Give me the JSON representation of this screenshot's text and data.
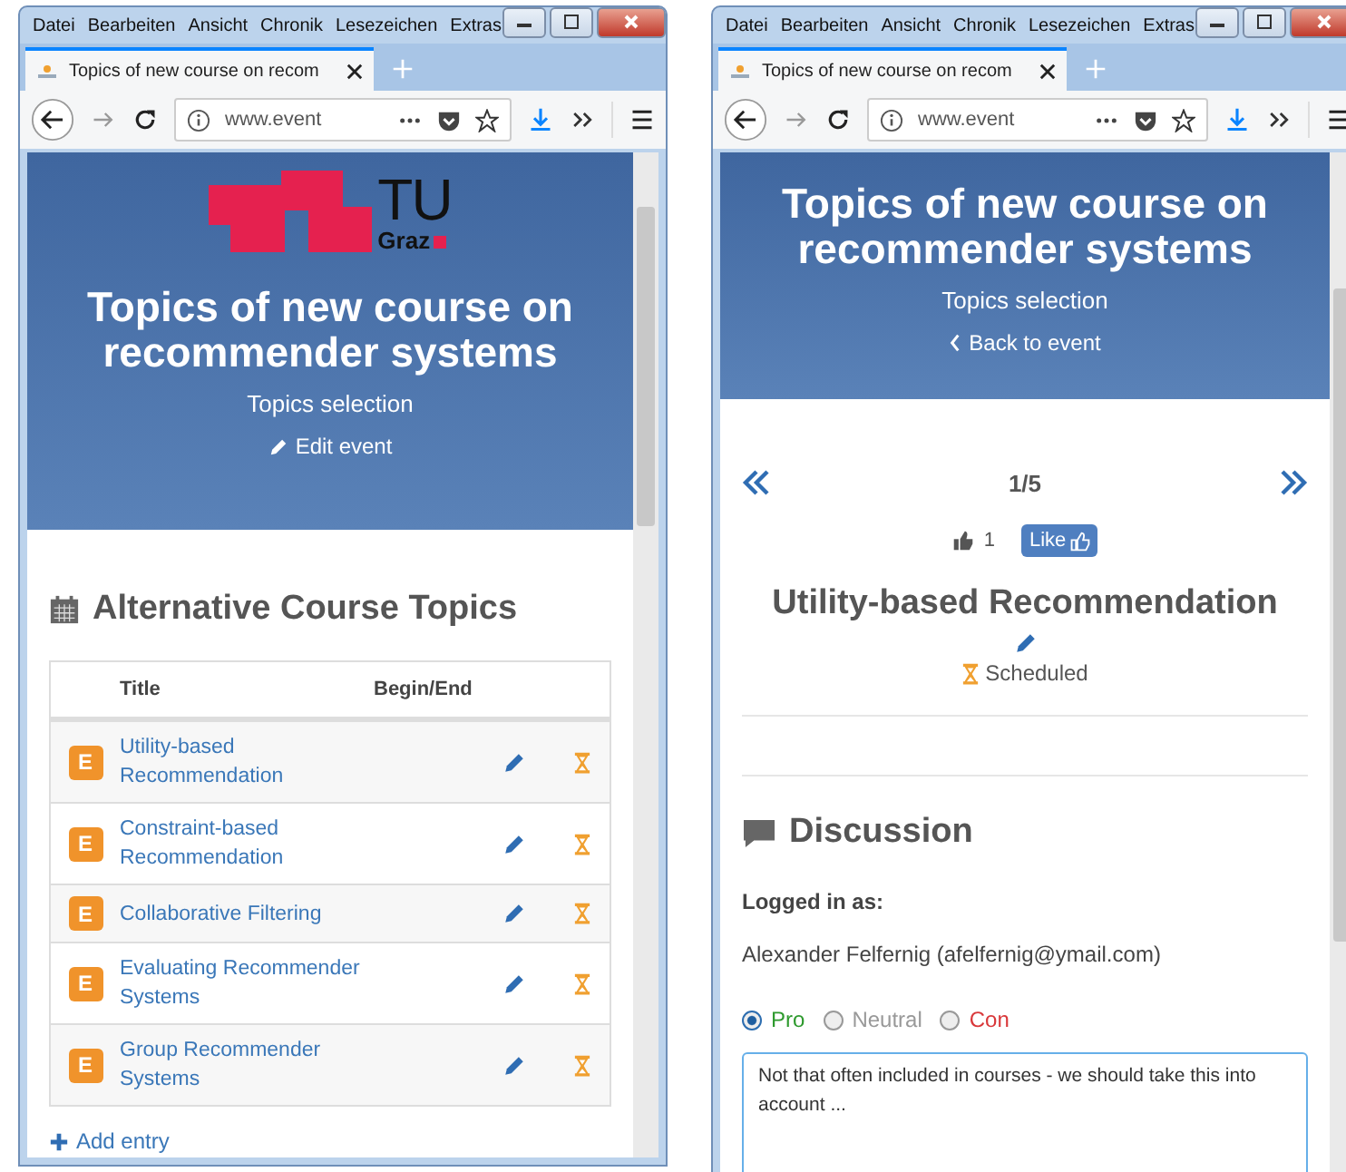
{
  "windows": [
    {
      "menu": [
        "Datei",
        "Bearbeiten",
        "Ansicht",
        "Chronik",
        "Lesezeichen",
        "Extras"
      ],
      "tab_title": "Topics of new course on recom",
      "url": "www.event",
      "page": {
        "kind": "overview",
        "logo_text": "TU",
        "logo_subtext": "Graz",
        "title": "Topics of new course on recommender systems",
        "subtitle": "Topics selection",
        "edit_link": "Edit event",
        "section_title": "Alternative Course Topics",
        "columns": [
          "Title",
          "Begin/End"
        ],
        "rows": [
          {
            "badge": "E",
            "title": "Utility-based Recommendation"
          },
          {
            "badge": "E",
            "title": "Constraint-based Recommendation"
          },
          {
            "badge": "E",
            "title": "Collaborative Filtering"
          },
          {
            "badge": "E",
            "title": "Evaluating Recommender Systems"
          },
          {
            "badge": "E",
            "title": "Group Recommender Systems"
          }
        ],
        "add_link": "Add entry"
      }
    },
    {
      "menu": [
        "Datei",
        "Bearbeiten",
        "Ansicht",
        "Chronik",
        "Lesezeichen",
        "Extras"
      ],
      "tab_title": "Topics of new course on recom",
      "url": "www.event",
      "page": {
        "kind": "detail",
        "title": "Topics of new course on recommender systems",
        "subtitle": "Topics selection",
        "back_link": "Back to event",
        "pager": "1/5",
        "like_count": "1",
        "like_button": "Like",
        "topic_title": "Utility-based Recommendation",
        "status": "Scheduled",
        "section_title": "Discussion",
        "logged_in_label": "Logged in as:",
        "user": "Alexander Felfernig (afelfernig@ymail.com)",
        "stances": [
          {
            "label": "Pro",
            "selected": true,
            "color": "#2e9a2e"
          },
          {
            "label": "Neutral",
            "selected": false,
            "color": "#999999"
          },
          {
            "label": "Con",
            "selected": false,
            "color": "#d9383a"
          }
        ],
        "comment": "Not that often included in courses - we should take this into account ..."
      }
    }
  ]
}
